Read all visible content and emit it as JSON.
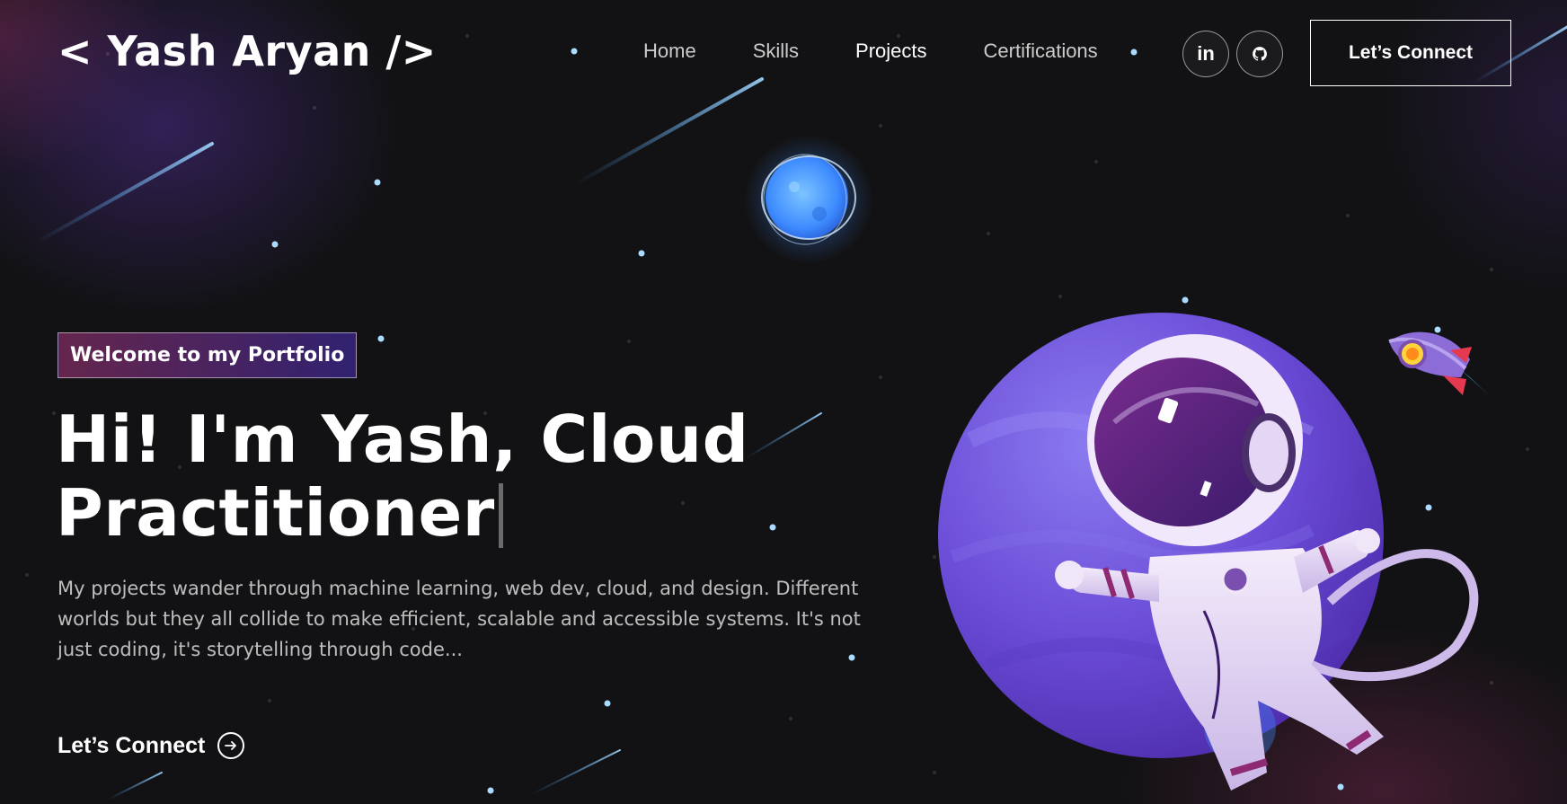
{
  "header": {
    "logo": "< Yash Aryan />",
    "nav": [
      {
        "label": "Home"
      },
      {
        "label": "Skills"
      },
      {
        "label": "Projects"
      },
      {
        "label": "Certifications"
      }
    ],
    "social": [
      {
        "icon": "linkedin-icon",
        "glyph": "in"
      },
      {
        "icon": "github-icon"
      }
    ],
    "connect_label": "Let’s Connect"
  },
  "hero": {
    "tagline": "Welcome to my Portfolio",
    "headline": "Hi! I'm Yash, Cloud Practitioner",
    "intro": "My projects wander through machine learning, web dev, cloud, and design. Different worlds but they all collide to make efficient, scalable and accessible systems. It's not just coding, it's storytelling through code...",
    "cta_label": "Let’s Connect",
    "cta_icon": "arrow-right-circle-icon"
  },
  "colors": {
    "background": "#121214",
    "tagline_gradient_start": "#AA367C",
    "tagline_gradient_end": "#4A2FBD",
    "text": "#FFFFFF"
  }
}
